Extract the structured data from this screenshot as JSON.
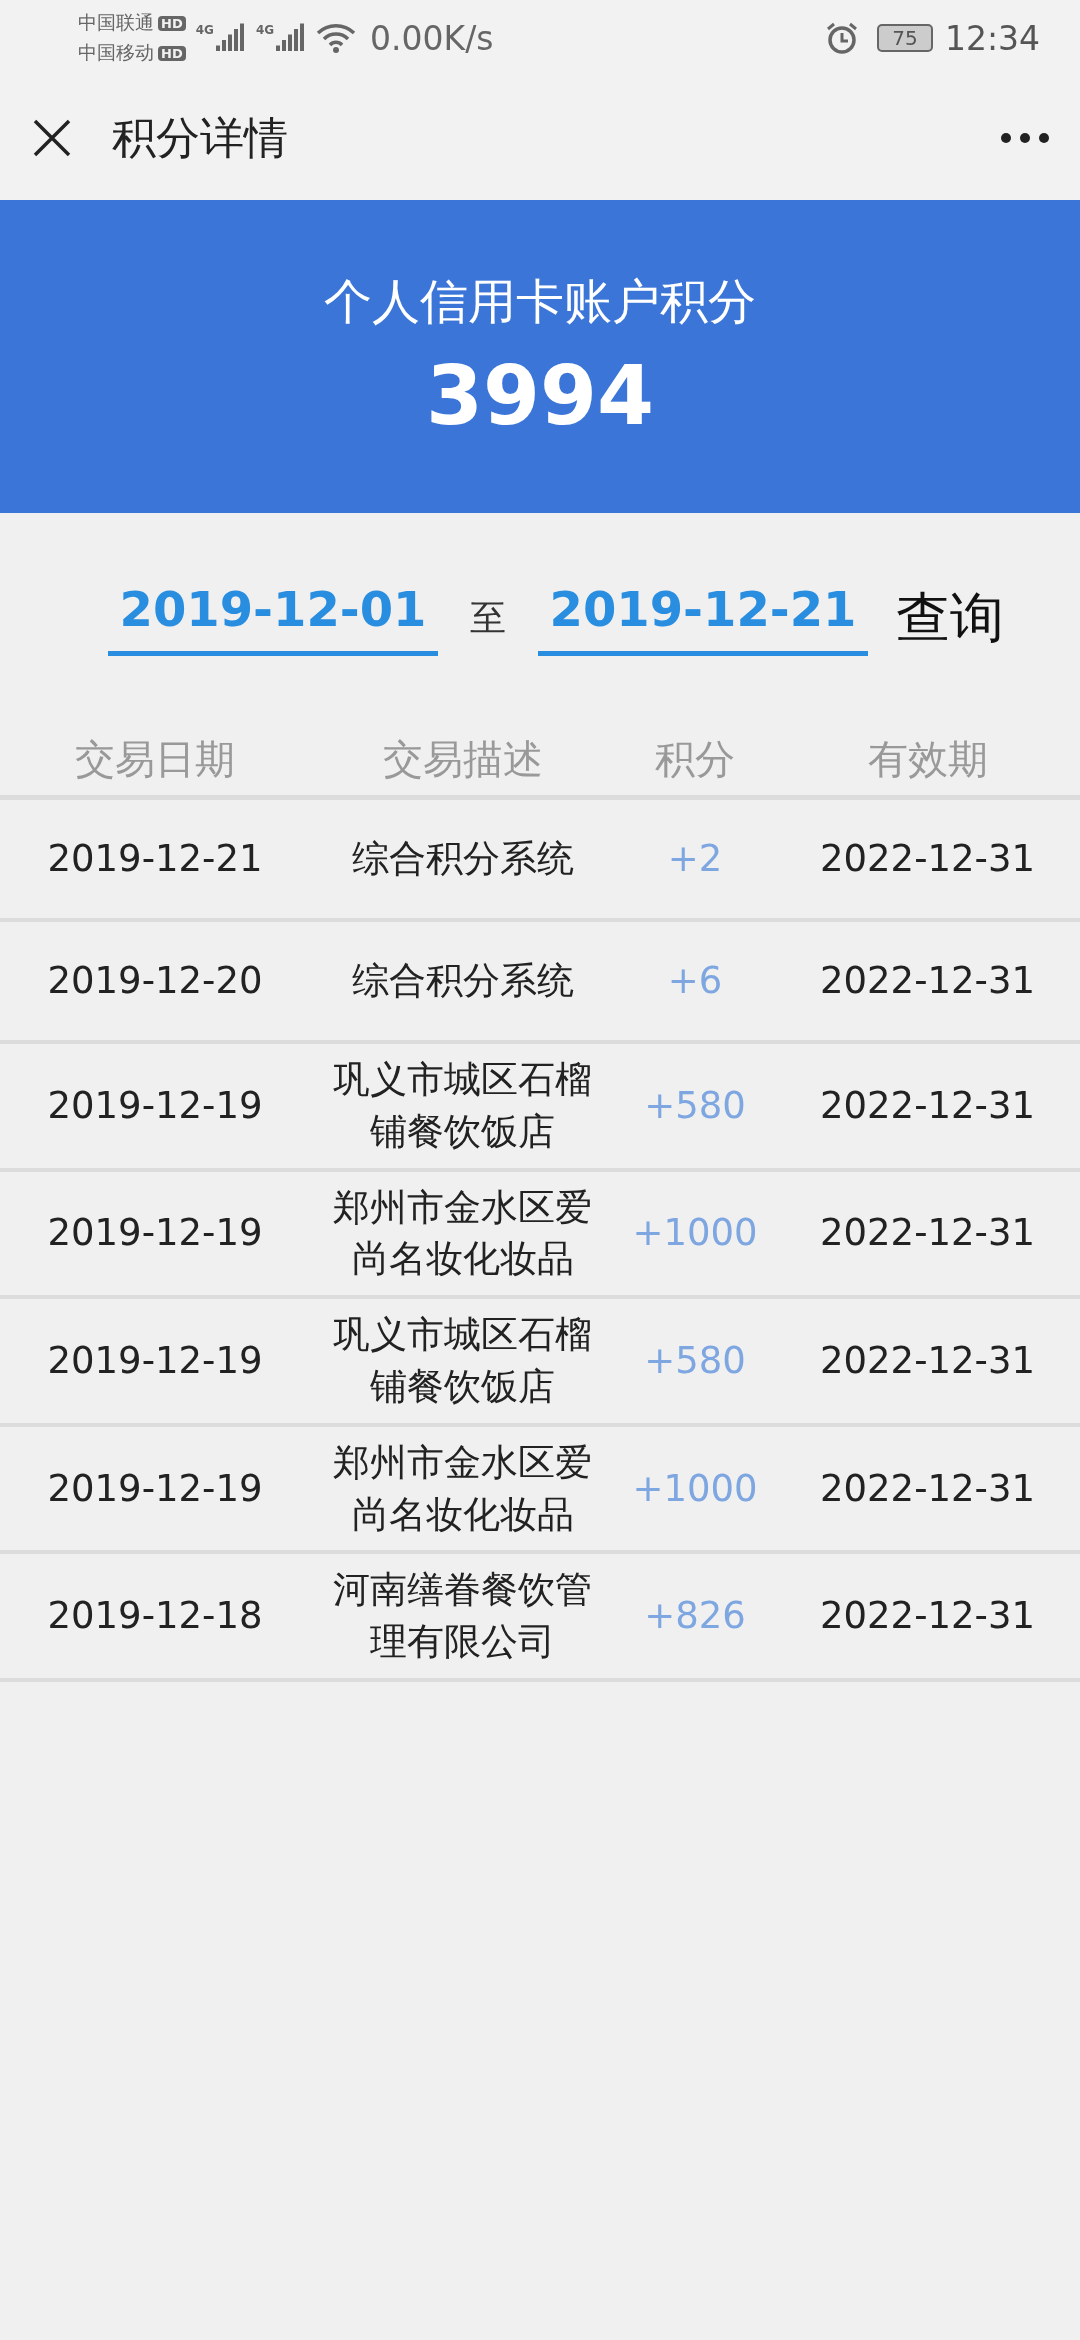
{
  "status_bar": {
    "carriers": [
      "中国联通",
      "中国移动"
    ],
    "carrier_badges": [
      "HD",
      "HD"
    ],
    "network_labels": [
      "4G",
      "4G"
    ],
    "speed": "0.00K/s",
    "battery": "75",
    "time": "12:34"
  },
  "header": {
    "title": "积分详情"
  },
  "banner": {
    "title": "个人信用卡账户积分",
    "points": "3994"
  },
  "date_range": {
    "start": "2019-12-01",
    "separator": "至",
    "end": "2019-12-21",
    "query_button": "查询"
  },
  "table": {
    "columns": [
      "交易日期",
      "交易描述",
      "积分",
      "有效期"
    ],
    "rows": [
      {
        "date": "2019-12-21",
        "description": "综合积分系统",
        "points": "+2",
        "expiry": "2022-12-31"
      },
      {
        "date": "2019-12-20",
        "description": "综合积分系统",
        "points": "+6",
        "expiry": "2022-12-31"
      },
      {
        "date": "2019-12-19",
        "description": "巩义市城区石榴铺餐饮饭店",
        "points": "+580",
        "expiry": "2022-12-31"
      },
      {
        "date": "2019-12-19",
        "description": "郑州市金水区爱尚名妆化妆品",
        "points": "+1000",
        "expiry": "2022-12-31"
      },
      {
        "date": "2019-12-19",
        "description": "巩义市城区石榴铺餐饮饭店",
        "points": "+580",
        "expiry": "2022-12-31"
      },
      {
        "date": "2019-12-19",
        "description": "郑州市金水区爱尚名妆化妆品",
        "points": "+1000",
        "expiry": "2022-12-31"
      },
      {
        "date": "2019-12-18",
        "description": "河南缮眷餐饮管理有限公司",
        "points": "+826",
        "expiry": "2022-12-31"
      }
    ]
  }
}
